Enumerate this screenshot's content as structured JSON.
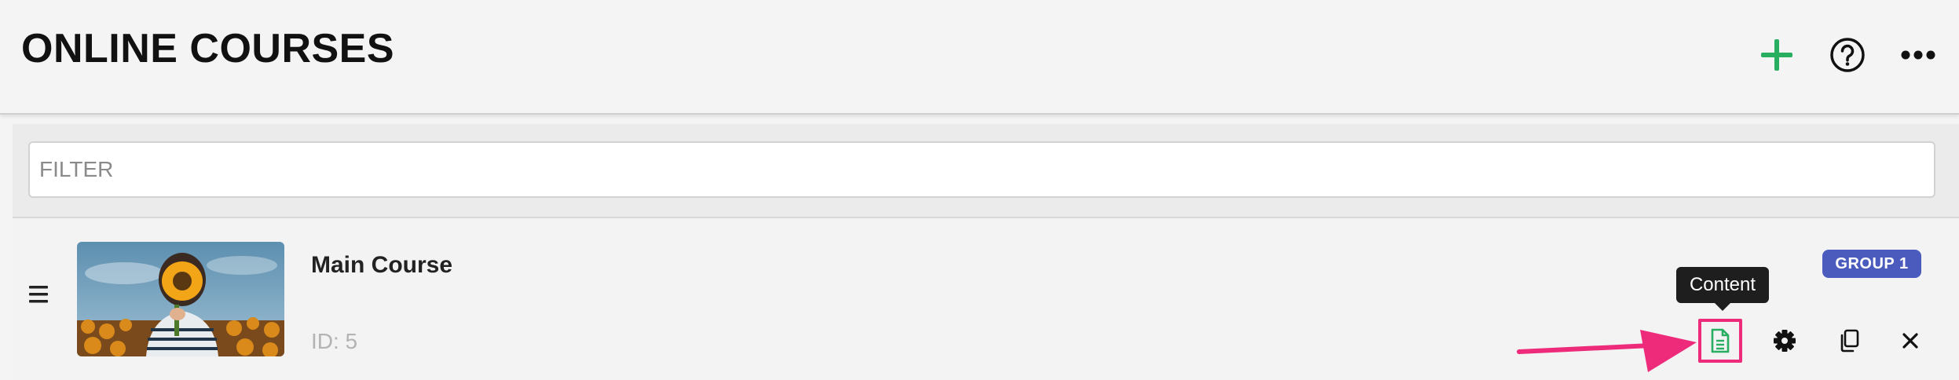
{
  "header": {
    "title": "ONLINE COURSES",
    "icons": [
      "add-icon",
      "help-icon",
      "more-icon"
    ]
  },
  "filter": {
    "placeholder": "FILTER",
    "value": ""
  },
  "courses": [
    {
      "name": "Main Course",
      "id_label": "ID: 5",
      "group": "GROUP 1",
      "thumbnail": "person-holding-sunflower-image",
      "actions": [
        "content-icon",
        "settings-icon",
        "duplicate-icon",
        "delete-icon"
      ]
    }
  ],
  "tooltip": {
    "text": "Content"
  },
  "colors": {
    "accent_green": "#27ae60",
    "badge_blue": "#4a5bbd",
    "highlight_pink": "#ee2a7b",
    "tooltip_bg": "#1e1e1e"
  }
}
